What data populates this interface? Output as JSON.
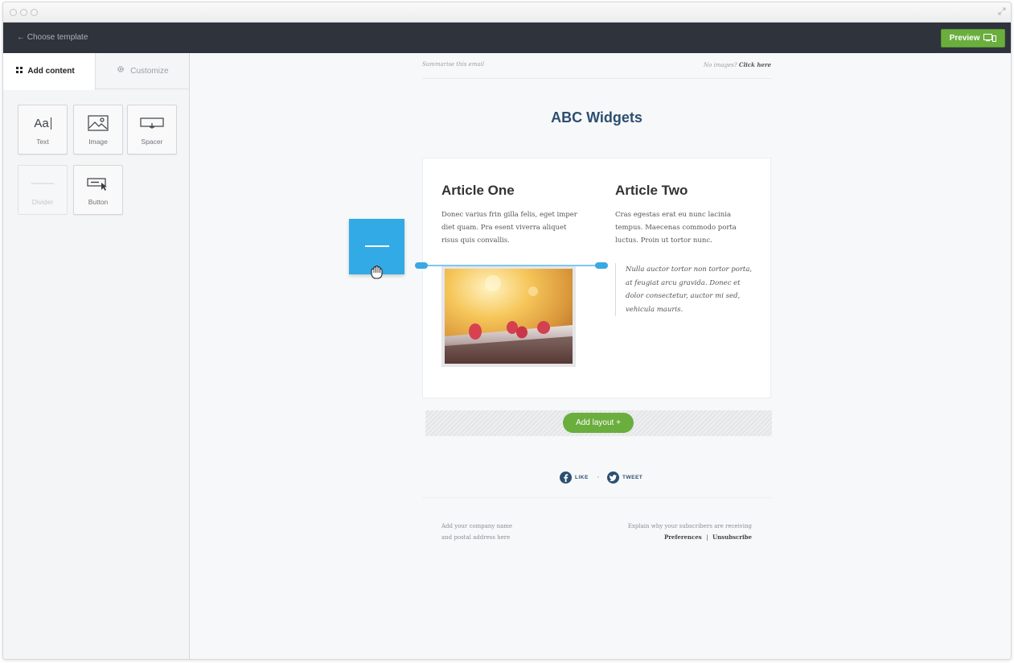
{
  "toolbar": {
    "back_label": "← Choose template",
    "preview_label": "Preview"
  },
  "sidebar": {
    "tabs": [
      {
        "label": "Add content",
        "icon": "grid-icon",
        "active": true
      },
      {
        "label": "Customize",
        "icon": "gear-icon",
        "active": false
      }
    ],
    "tiles": [
      {
        "label": "Text",
        "icon": "text-icon",
        "glyph": "Aa",
        "enabled": true
      },
      {
        "label": "Image",
        "icon": "image-icon",
        "enabled": true
      },
      {
        "label": "Spacer",
        "icon": "spacer-icon",
        "enabled": true
      },
      {
        "label": "Divider",
        "icon": "divider-icon",
        "enabled": false
      },
      {
        "label": "Button",
        "icon": "button-icon",
        "enabled": true
      }
    ]
  },
  "email": {
    "preheader_left": "Summarise this email",
    "preheader_right_prefix": "No images?",
    "preheader_right_link": "Click here",
    "title": "ABC Widgets",
    "article_one": {
      "heading": "Article One",
      "body": "Donec varius frin gilla felis, eget imper diet quam. Pra esent viverra aliquet risus quis convallis."
    },
    "article_two": {
      "heading": "Article Two",
      "body": "Cras egestas erat eu nunc lacinia tempus. Maecenas commodo porta luctus. Proin ut tortor nunc.",
      "quote": "Nulla auctor tortor non tortor porta, at feugiat arcu gravida. Donec et dolor consectetur, auctor mi sed, vehicula mauris."
    },
    "add_layout_label": "Add layout  +",
    "social": {
      "like": "LIKE",
      "tweet": "TWEET"
    },
    "footer": {
      "address_line1": "Add your company name",
      "address_line2": "and postal address here",
      "reason": "Explain why your subscribers are receiving",
      "preferences": "Preferences",
      "separator": "|",
      "unsubscribe": "Unsubscribe"
    }
  },
  "colors": {
    "topbar": "#2f343c",
    "accent_green": "#6aae3e",
    "drag_blue": "#32aae6",
    "title_blue": "#2c4f71"
  }
}
